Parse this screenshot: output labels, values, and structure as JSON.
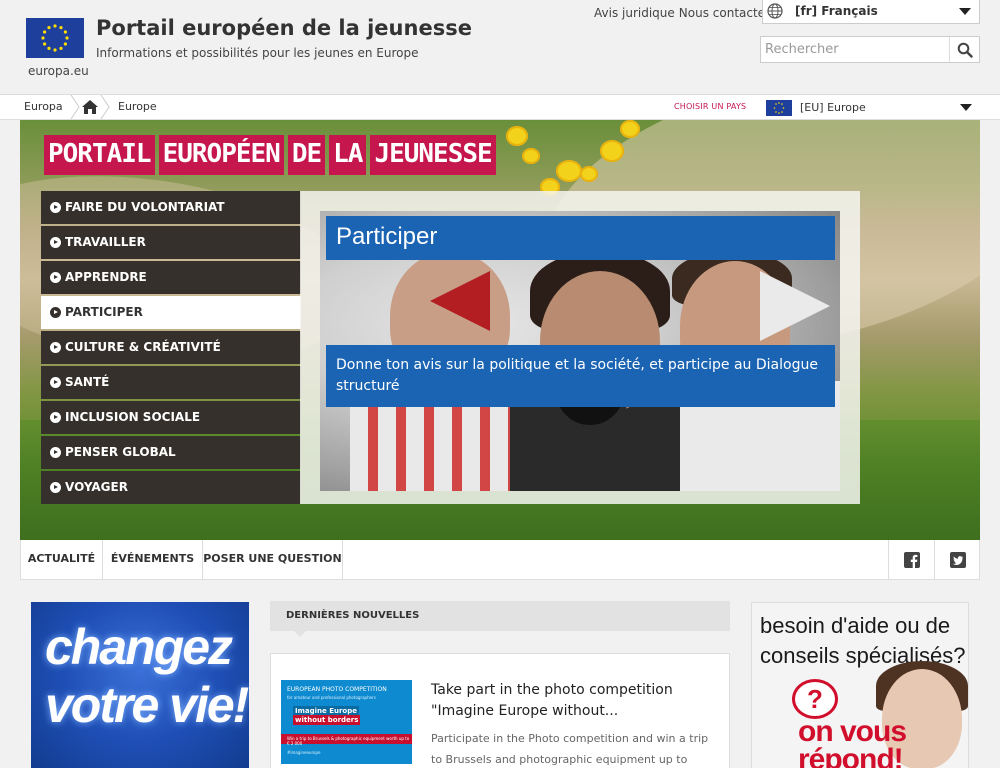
{
  "header": {
    "europa_label": "europa.eu",
    "title": "Portail européen de la jeunesse",
    "subtitle": "Informations et possibilités pour les jeunes en Europe",
    "links": [
      "Avis juridique",
      "Contactez-nous"
    ],
    "links_display": [
      "Avis juridique",
      "Nous contacter"
    ],
    "language": "[fr] Français",
    "search_placeholder": "Rechercher"
  },
  "breadcrumb": {
    "items": [
      "Europa",
      "Europe"
    ],
    "choose_country": "CHOISIR UN PAYS",
    "region": "[EU] Europe"
  },
  "hero": {
    "banner_words": [
      "PORTAIL",
      "EUROPÉEN",
      "DE",
      "LA",
      "JEUNESSE"
    ],
    "menu": [
      {
        "label": "FAIRE DU VOLONTARIAT",
        "active": false
      },
      {
        "label": "TRAVAILLER",
        "active": false
      },
      {
        "label": "APPRENDRE",
        "active": false
      },
      {
        "label": "PARTICIPER",
        "active": true
      },
      {
        "label": "CULTURE & CRÉATIVITÉ",
        "active": false
      },
      {
        "label": "SANTÉ",
        "active": false
      },
      {
        "label": "INCLUSION SOCIALE",
        "active": false
      },
      {
        "label": "PENSER GLOBAL",
        "active": false
      },
      {
        "label": "VOYAGER",
        "active": false
      }
    ],
    "panel_title": "Participer",
    "panel_description": "Donne ton avis sur la politique et la société, et participe au Dialogue structuré"
  },
  "tabs": [
    "ACTUALITÉ",
    "ÉVÉNEMENTS",
    "POSER UNE QUESTION"
  ],
  "social": [
    "facebook-icon",
    "twitter-icon"
  ],
  "promo_left": {
    "line1": "changez",
    "line2": "votre vie!"
  },
  "news": {
    "heading": "DERNIÈRES NOUVELLES",
    "thumb": {
      "line1": "EUROPEAN PHOTO COMPETITION",
      "line2": "for amateur and professional photographers",
      "line3": "Imagine Europe",
      "line4": "without borders",
      "bar": "Win a trip to Brussels & photographic equipment worth up to € 2 000",
      "line5": "#imagineeurope"
    },
    "title": "Take part in the photo competition \"Imagine Europe without...",
    "text": "Participate in the Photo competition and win a trip to Brussels and photographic equipment up to"
  },
  "promo_right": {
    "question": "besoin d'aide ou de conseils spécialisés?",
    "q_line1": "besoin d'aide ou de",
    "q_line2": "conseils spécialisés?",
    "answer1": "on vous",
    "answer2": "répond!"
  }
}
